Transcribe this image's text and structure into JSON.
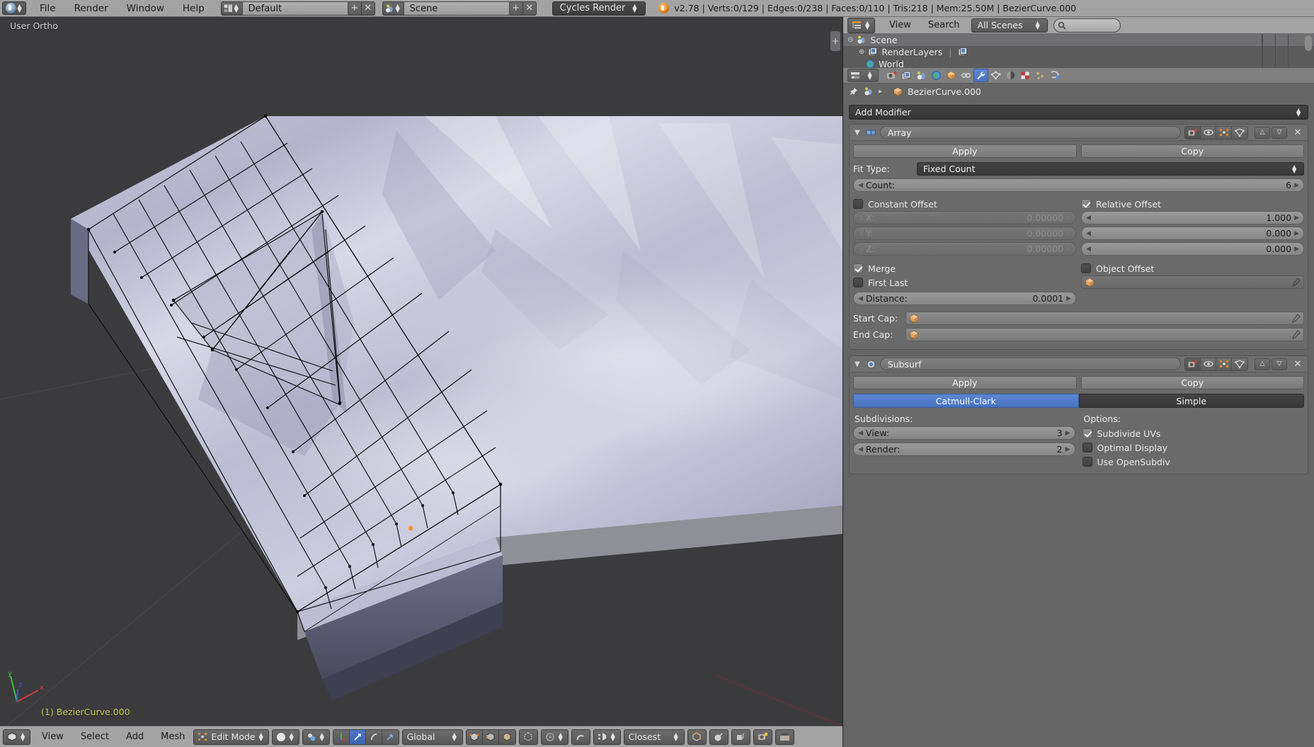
{
  "topbar": {
    "app_icon": "blender-logo-icon",
    "menus": [
      "File",
      "Render",
      "Window",
      "Help"
    ],
    "screen_layout": {
      "icon": "screen-layout-icon",
      "value": "Default",
      "add": "+",
      "remove": "✕"
    },
    "scene_selector": {
      "icon": "scene-icon",
      "value": "Scene",
      "add": "+",
      "remove": "✕"
    },
    "render_engine": {
      "value": "Cycles Render",
      "arrow": "⇅"
    },
    "status": {
      "version": "v2.78",
      "verts": "Verts:0/129",
      "edges": "Edges:0/238",
      "faces": "Faces:0/110",
      "tris": "Tris:218",
      "mem": "Mem:25.50M",
      "object": "BezierCurve.000",
      "full": "v2.78 | Verts:0/129 | Edges:0/238 | Faces:0/110 | Tris:218 | Mem:25.50M | BezierCurve.000"
    }
  },
  "viewport": {
    "view_label": "User Ortho",
    "object_label": "(1) BezierCurve.000",
    "axis_x": "x",
    "axis_y": "y",
    "axis_z": "z",
    "colors": {
      "background": "#3b3b3e",
      "mesh_light": "#cfcfe2",
      "mesh_dark": "#4a4a60",
      "wire": "#101010"
    }
  },
  "viewport_footer": {
    "editor_icon": "editor-type-icon",
    "menus": [
      "View",
      "Select",
      "Add",
      "Mesh"
    ],
    "mode": {
      "icon": "edit-mode-icon",
      "value": "Edit Mode",
      "arrow": "⇅"
    },
    "shading": {
      "icon": "shading-sphere-icon",
      "arrow": "⇅"
    },
    "pivot": {
      "icon": "pivot-icon",
      "arrow": "⇅"
    },
    "manipulator_icons": [
      "manipulator-toggle-icon",
      "translate-manipulator-icon",
      "rotate-manipulator-icon",
      "scale-manipulator-icon"
    ],
    "transform_orientation": {
      "value": "Global",
      "arrow": "⇅"
    },
    "select_modes": [
      "vertex-select-icon",
      "edge-select-icon",
      "face-select-icon"
    ],
    "occlude_icon": "occlude-geometry-icon",
    "proportional": {
      "icon": "proportional-edit-icon",
      "arrow": "⇅"
    },
    "magnet_icon": "snap-magnet-icon",
    "snap_element": {
      "icon": "snap-element-icon",
      "arrow": "⇅"
    },
    "snap_target": {
      "value": "Closest",
      "arrow": "⇅"
    },
    "extra_icons": [
      "snap-vertex-icon",
      "snap-volume-icon",
      "mesh-display-icon",
      "render-preview-icon",
      "render-animation-icon"
    ]
  },
  "outliner": {
    "editor_icon": "outliner-editor-icon",
    "menus": [
      "View",
      "Search"
    ],
    "display_mode": {
      "value": "All Scenes",
      "arrow": "⇅"
    },
    "search": {
      "placeholder": "",
      "value": "",
      "icon": "search-icon"
    },
    "rows": [
      {
        "expander": "⊖",
        "icon": "scene-icon",
        "label": "Scene",
        "selected": true,
        "indent": 0
      },
      {
        "expander": "⊕",
        "icon": "renderlayers-icon",
        "label": "RenderLayers",
        "selected": false,
        "indent": 1,
        "extra_icon": "renderlayers-icon"
      },
      {
        "expander": "",
        "icon": "world-icon",
        "label": "World",
        "selected": false,
        "indent": 1
      }
    ]
  },
  "properties": {
    "tabs": [
      {
        "name": "render",
        "icon": "camera-render-icon",
        "active": false
      },
      {
        "name": "render-layers",
        "icon": "render-layers-icon",
        "active": false
      },
      {
        "name": "scene",
        "icon": "scene-props-icon",
        "active": false
      },
      {
        "name": "world",
        "icon": "world-icon",
        "active": false
      },
      {
        "name": "object",
        "icon": "object-cube-icon",
        "active": false
      },
      {
        "name": "constraints",
        "icon": "chain-constraint-icon",
        "active": false
      },
      {
        "name": "modifiers",
        "icon": "wrench-icon",
        "active": true
      },
      {
        "name": "data",
        "icon": "mesh-data-icon",
        "active": false
      },
      {
        "name": "material",
        "icon": "material-sphere-icon",
        "active": false
      },
      {
        "name": "texture",
        "icon": "texture-checker-icon",
        "active": false
      },
      {
        "name": "particles",
        "icon": "particles-icon",
        "active": false
      },
      {
        "name": "physics",
        "icon": "physics-icon",
        "active": false
      }
    ],
    "breadcrumb": {
      "pin_icon": "pin-icon",
      "scene_icon": "scene-icon",
      "separator": "▸",
      "object_icon": "object-cube-icon",
      "object_name": "BezierCurve.000"
    },
    "add_modifier": {
      "label": "Add Modifier",
      "arrow": "⇅"
    },
    "modifiers": [
      {
        "id": "array",
        "collapse_icon": "triangle-down-icon",
        "type_icon": "array-modifier-icon",
        "name": "Array",
        "header_toggles": [
          "render-toggle-icon",
          "realtime-eye-icon",
          "edit-mode-toggle-icon",
          "on-cage-icon"
        ],
        "move_up": "△",
        "move_down": "▽",
        "close": "✕",
        "apply_label": "Apply",
        "copy_label": "Copy",
        "fit_type_label": "Fit Type:",
        "fit_type_value": "Fixed Count",
        "count_label": "Count:",
        "count_value": "6",
        "constant_offset": {
          "label": "Constant Offset",
          "checked": false,
          "enabled": false,
          "fields": [
            {
              "label": "X:",
              "value": "0.00000"
            },
            {
              "label": "Y:",
              "value": "0.00000"
            },
            {
              "label": "Z:",
              "value": "0.00000"
            }
          ]
        },
        "relative_offset": {
          "label": "Relative Offset",
          "checked": true,
          "enabled": true,
          "fields": [
            {
              "label": "",
              "value": "1.000"
            },
            {
              "label": "",
              "value": "0.000"
            },
            {
              "label": "",
              "value": "0.000"
            }
          ]
        },
        "merge": {
          "label": "Merge",
          "checked": true
        },
        "first_last": {
          "label": "First Last",
          "checked": false
        },
        "distance_label": "Distance:",
        "distance_value": "0.0001",
        "object_offset": {
          "label": "Object Offset",
          "checked": false,
          "field_value": "",
          "icon": "object-cube-icon",
          "picker_icon": "eyedropper-icon"
        },
        "start_cap": {
          "label": "Start Cap:",
          "value": "",
          "icon": "object-cube-icon",
          "picker_icon": "eyedropper-icon"
        },
        "end_cap": {
          "label": "End Cap:",
          "value": "",
          "icon": "object-cube-icon",
          "picker_icon": "eyedropper-icon"
        }
      },
      {
        "id": "subsurf",
        "collapse_icon": "triangle-down-icon",
        "type_icon": "subsurf-modifier-icon",
        "name": "Subsurf",
        "header_toggles": [
          "render-toggle-icon",
          "realtime-eye-icon",
          "edit-mode-toggle-icon",
          "on-cage-icon"
        ],
        "move_up": "△",
        "move_down": "▽",
        "close": "✕",
        "apply_label": "Apply",
        "copy_label": "Copy",
        "algorithm": {
          "options": [
            "Catmull-Clark",
            "Simple"
          ],
          "selected": "Catmull-Clark"
        },
        "subdivisions_label": "Subdivisions:",
        "view_label": "View:",
        "view_value": "3",
        "render_label": "Render:",
        "render_value": "2",
        "options_label": "Options:",
        "options": [
          {
            "label": "Subdivide UVs",
            "checked": true
          },
          {
            "label": "Optimal Display",
            "checked": false
          },
          {
            "label": "Use OpenSubdiv",
            "checked": false
          }
        ]
      }
    ]
  },
  "colors": {
    "accent_blue": "#4d79c8",
    "header_grey": "#a3a3a3",
    "panel_grey": "#656565",
    "dark_field": "#383838",
    "object_label_yellow": "#c9d04a"
  }
}
